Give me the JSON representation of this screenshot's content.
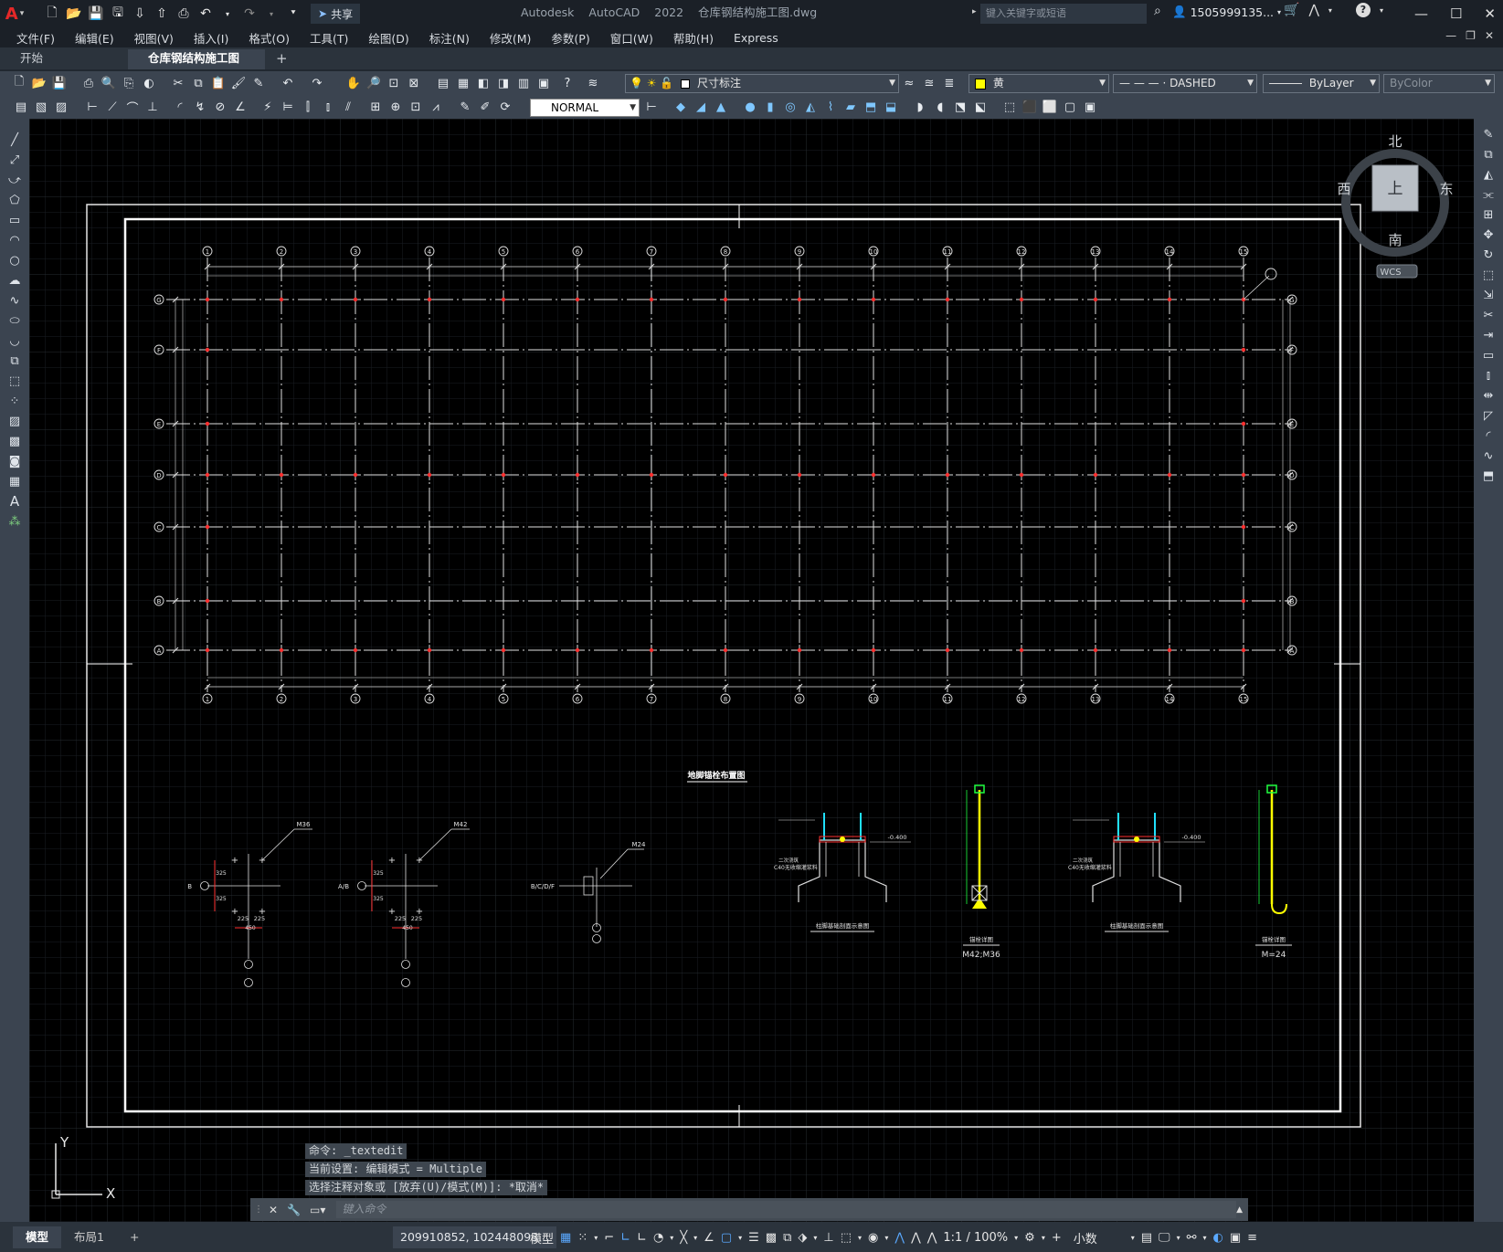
{
  "app": {
    "title": "Autodesk AutoCAD 2022    仓库钢结构施工图.dwg",
    "share_label": "共享",
    "search_placeholder": "键入关键字或短语",
    "user": "1505999135...",
    "accent_color": "#e52828"
  },
  "menu": [
    "文件(F)",
    "编辑(E)",
    "视图(V)",
    "插入(I)",
    "格式(O)",
    "工具(T)",
    "绘图(D)",
    "标注(N)",
    "修改(M)",
    "参数(P)",
    "窗口(W)",
    "帮助(H)",
    "Express"
  ],
  "tabs": {
    "start": "开始",
    "active": "仓库钢结构施工图*"
  },
  "toolbar": {
    "layer": "尺寸标注",
    "color": "黄",
    "linetype": "— — — · DASHED",
    "lineweight": "ByLayer",
    "plotstyle": "ByColor",
    "textstyle": "NORMAL"
  },
  "viewcube": {
    "north": "北",
    "south": "南",
    "east": "东",
    "west": "西",
    "top": "上",
    "wcs": "WCS"
  },
  "ucs": {
    "x": "X",
    "y": "Y"
  },
  "drawing": {
    "plan_title": "地脚锚栓布置图",
    "col_nums": [
      "1",
      "2",
      "3",
      "4",
      "5",
      "6",
      "7",
      "8",
      "9",
      "10",
      "11",
      "12",
      "13",
      "14",
      "15"
    ],
    "row_letters": [
      "G",
      "F",
      "E",
      "D",
      "C",
      "B",
      "A"
    ],
    "anchor_labels": [
      "M36",
      "M42",
      "M24"
    ],
    "detail_labels": [
      "柱脚基础剖面示意图",
      "锚栓详图",
      "柱脚基础剖面示意图",
      "锚栓详图"
    ],
    "detail_sub": [
      "M42;M36",
      "M=24"
    ],
    "elev_note": "-0.400",
    "dims": [
      "325",
      "325",
      "225",
      "225",
      "450"
    ],
    "grid_markers": [
      "B",
      "A/B",
      "B/C/D/F"
    ],
    "concrete_note": "C40无收缩灌浆料",
    "secondary_note": "二次浇筑"
  },
  "command": {
    "history": [
      "命令: _textedit",
      "当前设置: 编辑模式 = Multiple",
      "选择注释对象或 [放弃(U)/模式(M)]: *取消*"
    ],
    "placeholder": "键入命令"
  },
  "status": {
    "tab_model": "模型",
    "tab_layout": "布局1",
    "coords": "209910852, 102448093...",
    "space": "模型",
    "scale": "1:1 / 100%",
    "units": "小数"
  }
}
